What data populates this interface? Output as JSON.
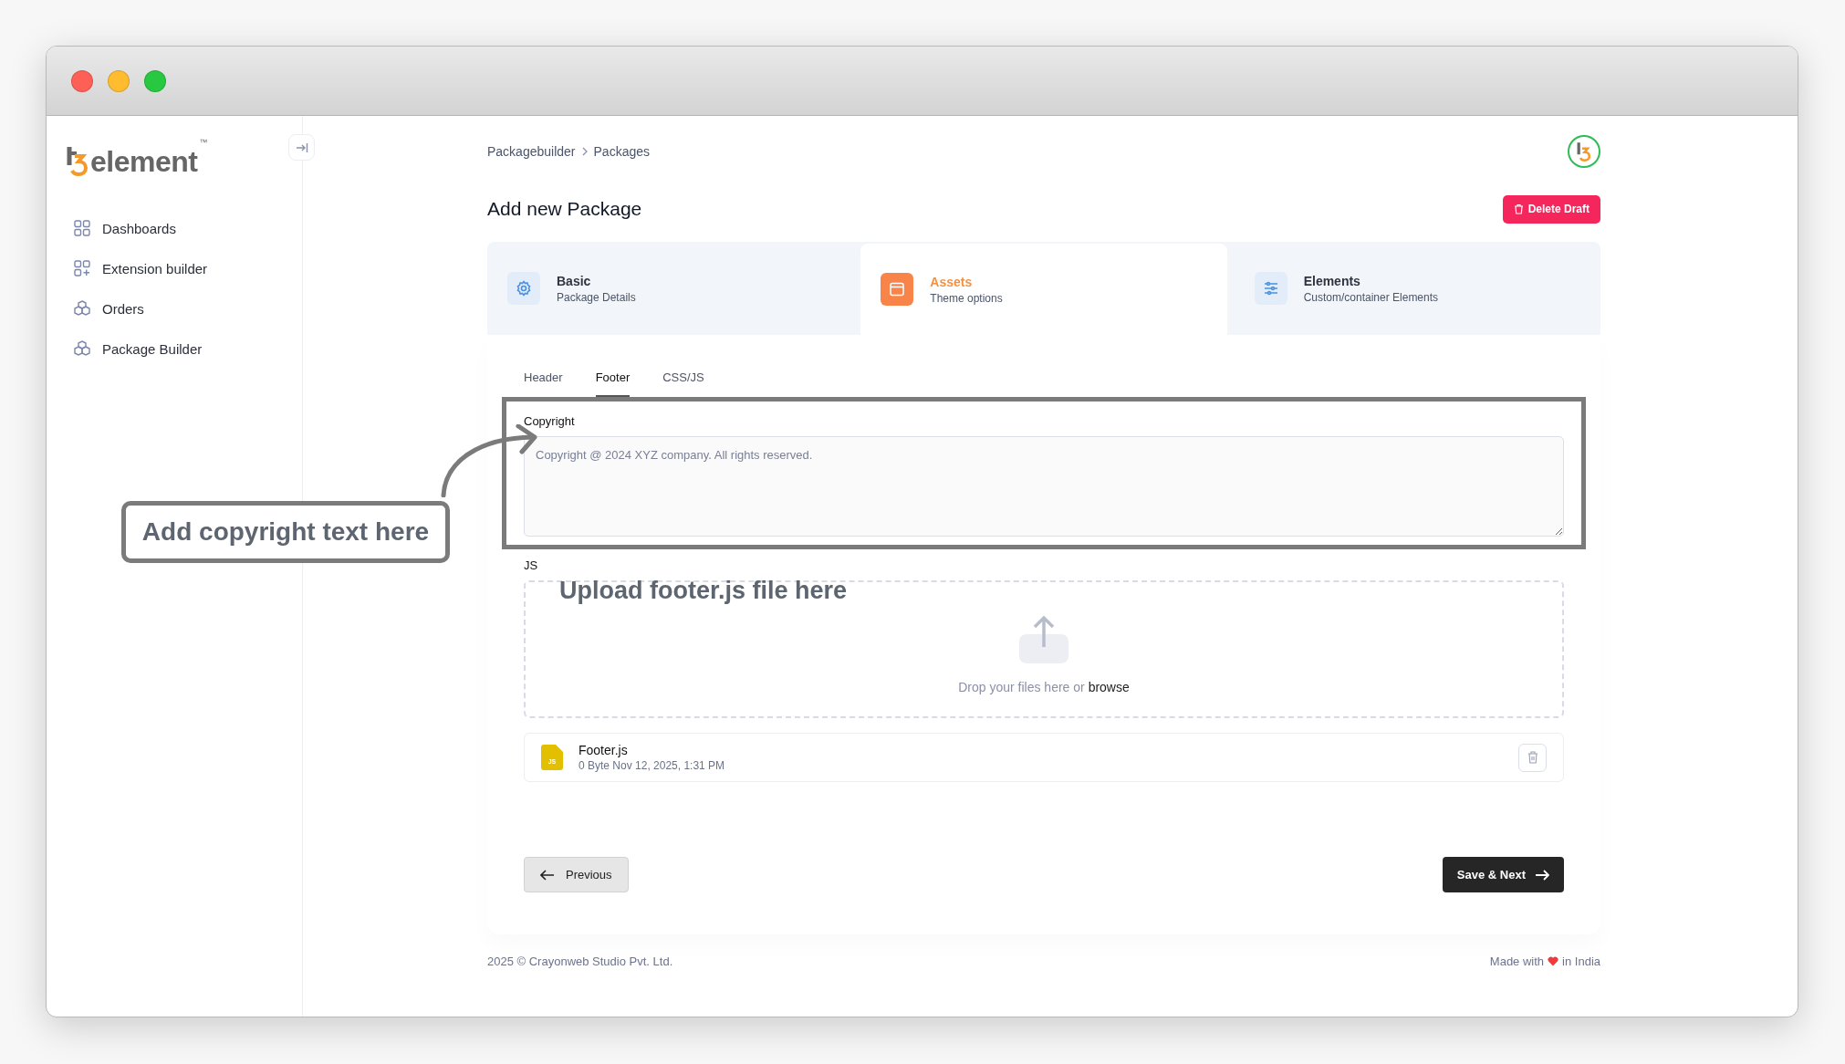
{
  "sidebar": {
    "logo": {
      "text": "element",
      "mark": "™"
    },
    "items": [
      {
        "kind": "grid",
        "label": "Dashboards",
        "selected": false
      },
      {
        "kind": "grid-plus",
        "label": "Extension builder",
        "selected": false
      },
      {
        "kind": "boxes",
        "label": "Orders",
        "selected": false
      },
      {
        "kind": "boxes",
        "label": "Package Builder",
        "selected": false
      }
    ]
  },
  "breadcrumb": [
    "Packagebuilder",
    "Packages"
  ],
  "page_title": "Add new Package",
  "delete_button": "Delete Draft",
  "steps": [
    {
      "kind": "gear",
      "title": "Basic",
      "subtitle": "Package Details",
      "selected": false
    },
    {
      "kind": "window",
      "title": "Assets",
      "subtitle": "Theme options",
      "selected": true
    },
    {
      "kind": "sliders",
      "title": "Elements",
      "subtitle": "Custom/container Elements",
      "selected": false
    }
  ],
  "tabs": [
    {
      "label": "Header",
      "selected": false
    },
    {
      "label": "Footer",
      "selected": true
    },
    {
      "label": "CSS/JS",
      "selected": false
    }
  ],
  "copyright": {
    "label": "Copyright",
    "placeholder": "Copyright @ 2024 XYZ company. All rights reserved."
  },
  "js": {
    "label": "JS",
    "drop_text": "Drop your files here or",
    "browse": "browse"
  },
  "file": {
    "name": "Footer.js",
    "meta": "0 Byte Nov 12, 2025, 1:31 PM",
    "badge": "JS"
  },
  "previous_button": "Previous",
  "next_button": "Save & Next",
  "footer": {
    "left": "2025 ©  Crayonweb Studio Pvt. Ltd.",
    "right_before": "Made with",
    "right_after": "in India"
  },
  "annotations": {
    "copyright_callout": "Add copyright text here",
    "upload_note": "Upload footer.js file here"
  }
}
